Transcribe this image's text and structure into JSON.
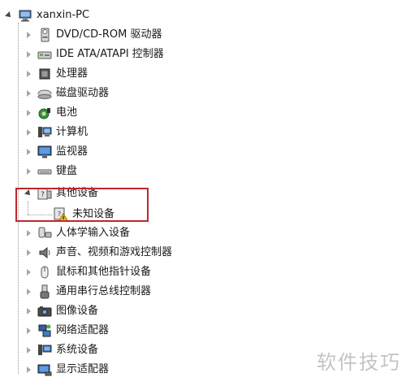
{
  "tree": {
    "root": {
      "label": "xanxin-PC",
      "icon": "computer-icon"
    },
    "items": [
      {
        "label": "DVD/CD-ROM 驱动器",
        "icon": "optical-drive-icon"
      },
      {
        "label": "IDE ATA/ATAPI 控制器",
        "icon": "ide-controller-icon"
      },
      {
        "label": "处理器",
        "icon": "processor-icon"
      },
      {
        "label": "磁盘驱动器",
        "icon": "disk-drive-icon"
      },
      {
        "label": "电池",
        "icon": "battery-icon"
      },
      {
        "label": "计算机",
        "icon": "computer-icon"
      },
      {
        "label": "监视器",
        "icon": "monitor-icon"
      },
      {
        "label": "键盘",
        "icon": "keyboard-icon"
      },
      {
        "label": "其他设备",
        "icon": "unknown-device-icon",
        "expanded": true,
        "children": [
          {
            "label": "未知设备",
            "icon": "warning-device-icon"
          }
        ]
      },
      {
        "label": "人体学输入设备",
        "icon": "hid-icon"
      },
      {
        "label": "声音、视频和游戏控制器",
        "icon": "speaker-icon"
      },
      {
        "label": "鼠标和其他指针设备",
        "icon": "mouse-icon"
      },
      {
        "label": "通用串行总线控制器",
        "icon": "usb-icon"
      },
      {
        "label": "图像设备",
        "icon": "camera-icon"
      },
      {
        "label": "网络适配器",
        "icon": "network-icon"
      },
      {
        "label": "系统设备",
        "icon": "system-device-icon"
      },
      {
        "label": "显示适配器",
        "icon": "display-adapter-icon"
      }
    ]
  },
  "watermark": "软件技巧",
  "colors": {
    "highlight_border": "#c0272d",
    "watermark": "#c4c4c4"
  }
}
